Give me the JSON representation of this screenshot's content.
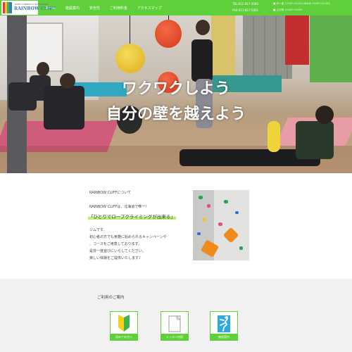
{
  "brand": {
    "tagline": "ROPE CLIMBING & BOULDERING",
    "name": "RAINBOW CLIFF"
  },
  "nav": {
    "items": [
      {
        "label": "ホーム"
      },
      {
        "label": "施設案内"
      },
      {
        "label": "安全性"
      },
      {
        "label": "ご利用料金"
      },
      {
        "label": "アクセスマップ"
      }
    ]
  },
  "contact": {
    "tel": "TEL:011-817-5000",
    "fax": "FAX:011-817-5001",
    "hours_weekday": "■ 月〜金 17:00〜22:00 (水のみ 13:00〜22:00)",
    "hours_weekend": "■ 土日祝 11:00〜20:00"
  },
  "hero": {
    "line1": "ワクワクしよう",
    "line2": "自分の壁を越えよう"
  },
  "about": {
    "title": "RAINBOW CLIFFについて",
    "lead": "RAINBOW CLIFFは、北海道で唯一!",
    "highlight": "「ひとりでロープクライミングが出来る」",
    "body": [
      "ジムです。",
      "初心者の方でも気軽に始められるキャンペーンや",
      "、コースをご用意しております。",
      "是非一度遊びにいらしてください。",
      "楽しい体験をご提供いたします♪"
    ]
  },
  "guide": {
    "title": "ご利用のご案内",
    "cards": [
      {
        "label": "初めての方へ",
        "icon": "beginner-mark-icon"
      },
      {
        "label": "レッスン内容",
        "icon": "document-icon"
      },
      {
        "label": "施設案内",
        "icon": "climber-icon"
      }
    ]
  },
  "colors": {
    "accent": "#5fcf3a",
    "highlight": "#b8ee7a",
    "guide_bg": "#f1f1f1"
  }
}
